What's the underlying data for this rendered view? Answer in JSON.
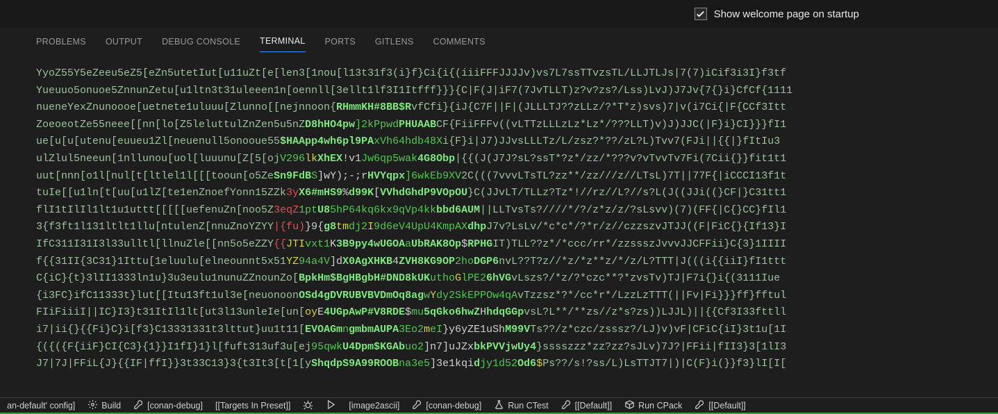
{
  "header": {
    "welcome_checkbox_label": "Show welcome page on startup",
    "welcome_checked": true
  },
  "panel": {
    "tabs": [
      {
        "label": "PROBLEMS",
        "active": false
      },
      {
        "label": "OUTPUT",
        "active": false
      },
      {
        "label": "DEBUG CONSOLE",
        "active": false
      },
      {
        "label": "TERMINAL",
        "active": true
      },
      {
        "label": "PORTS",
        "active": false
      },
      {
        "label": "GITLENS",
        "active": false
      },
      {
        "label": "COMMENTS",
        "active": false
      }
    ]
  },
  "terminal": {
    "lines": [
      [
        {
          "t": "YyoZ55Y5eZeeu5eZ5[eZn5utetIut[u11uZt[e[len3[1nou[l13t31f3(i}f}Ci{i{(iiiFFFJJJJv)vs7L7ssTTvzsTL/LLJTLJs|7(7)iCif3i3I}f3tf",
          "c": "wg"
        }
      ],
      [
        {
          "t": "Yueuuo5onuoe5ZnnunZetu[u1ltn3t31uleeen1n[oennll[3ellt1lf3I1Itfff}}}{C|F(J|iF7(7JvTLLT)z?v?zs?/Lss)LvJ)J7Jv{7{}i}CfCf{1111",
          "c": "wg"
        }
      ],
      [
        {
          "t": "nueneYexZnunoooe[uetnete1uluuu[Zlunno[[nejnnoon{",
          "c": "wg"
        },
        {
          "t": "RHmmKH#8BB$R",
          "c": "bg"
        },
        {
          "t": "vfCfi}{iJ{C7F||F|(JLLLTJ??zLLz/?*T*z)svs)7|v(i7Ci{|F{CCf3Itt",
          "c": "wg"
        }
      ],
      [
        {
          "t": "ZoeoeotZe55neee[[nn[lo[Z5leluttulZnZen5u5nZ",
          "c": "wg"
        },
        {
          "t": "D8hHO4pw",
          "c": "bg"
        },
        {
          "t": "]2kPpwd",
          "c": "g"
        },
        {
          "t": "PHUAAB",
          "c": "bg"
        },
        {
          "t": "CF{FiiFFFv((vLTTzLLLzLz*Lz*/???LLT)v)J)JJC(|F}i}CI}}}fI1",
          "c": "wg"
        }
      ],
      [
        {
          "t": "ue[u[u[utenu[euueu1Zl[neuenull5onooue55",
          "c": "wg"
        },
        {
          "t": "$HAApp4wh6pl9PA",
          "c": "bg"
        },
        {
          "t": "xVh64hdb48X",
          "c": "g"
        },
        {
          "t": "i{F}i|J7)JJvsLLLTz/L/zsz?*??/zL?L)Tvv7(FJi||{{|}fItIu3",
          "c": "wg"
        }
      ],
      [
        {
          "t": "ulZlul5neeun[1nllunou[uol[luuunu[Z[5[oj",
          "c": "wg"
        },
        {
          "t": "V296",
          "c": "g"
        },
        {
          "t": "lk",
          "c": "y"
        },
        {
          "t": "XhEX",
          "c": "bg"
        },
        {
          "t": "!v1",
          "c": "w"
        },
        {
          "t": "Jw6qp5wak",
          "c": "g"
        },
        {
          "t": "4G8Obp",
          "c": "bg"
        },
        {
          "t": "|{{(J(J7J?sL?ssT*?z*/zz/*???v?vTvvTv7Fi(7Cii{}}fit1t1",
          "c": "wg"
        }
      ],
      [
        {
          "t": "uut[nnn[o1l[nul[t[ltlel1l[[[tooun[o5Ze",
          "c": "wg"
        },
        {
          "t": "Sn9FdB",
          "c": "bg"
        },
        {
          "t": "S",
          "c": "g"
        },
        {
          "t": "]wY);-;r",
          "c": "w"
        },
        {
          "t": "HVYqpx",
          "c": "bg"
        },
        {
          "t": "]6wkEb9XV",
          "c": "g"
        },
        {
          "t": "2C(((7vvvLTsTL?zz**/zz///z//LTsL)7T||77F{|iCCCI13f1t",
          "c": "wg"
        }
      ],
      [
        {
          "t": "tuIe[[u1ln[t[uu[u1lZ[te1enZnoefYonn15ZZk",
          "c": "wg"
        },
        {
          "t": "3y",
          "c": "r"
        },
        {
          "t": "X6#mHS9",
          "c": "bg"
        },
        {
          "t": "%",
          "c": "w"
        },
        {
          "t": "d99K",
          "c": "bg"
        },
        {
          "t": "[",
          "c": "w"
        },
        {
          "t": "VVhdGhdP9VOpOU",
          "c": "bg"
        },
        {
          "t": "}C(JJvLT/TLLz?Tz*!//rz//L?//s?L(J((JJi((}CF|}C31tt1",
          "c": "wg"
        }
      ],
      [
        {
          "t": "flI1tIlIl1lt1u1uttt[[[[[uefenuZn[noo5Z",
          "c": "wg"
        },
        {
          "t": "3eqZ",
          "c": "r"
        },
        {
          "t": "1pt",
          "c": "g"
        },
        {
          "t": "U8",
          "c": "bg"
        },
        {
          "t": "5hP64kq6kx9qVp4kk",
          "c": "g"
        },
        {
          "t": "bbd6AUM",
          "c": "bg"
        },
        {
          "t": "||LLTvsTs?////*/?/z*z/z/?sLsvv)(7)(FF{|C{}CC}fIl1",
          "c": "wg"
        }
      ],
      [
        {
          "t": "3{f3ft1l131ltlt1llu[ntulenZ[nnuZnoYZYY",
          "c": "wg"
        },
        {
          "t": "|{fu)",
          "c": "r"
        },
        {
          "t": "}9{",
          "c": "w"
        },
        {
          "t": "g8",
          "c": "bg"
        },
        {
          "t": "tm",
          "c": "y"
        },
        {
          "t": "dj2",
          "c": "g"
        },
        {
          "t": "I",
          "c": "y"
        },
        {
          "t": "9d6eV4UpU4KmpAX",
          "c": "g"
        },
        {
          "t": "dhp",
          "c": "bg"
        },
        {
          "t": "J7v?LsLv/*c*c*/?*r/z//czzszvJTJJ((F|FiC{}{If13}I",
          "c": "wg"
        }
      ],
      [
        {
          "t": "IfC311I31I3l33ulltl[llnuZle[[nn5o5eZZY",
          "c": "wg"
        },
        {
          "t": "{{",
          "c": "r"
        },
        {
          "t": "JTI",
          "c": "y"
        },
        {
          "t": "vxt1",
          "c": "g"
        },
        {
          "t": "K",
          "c": "w"
        },
        {
          "t": "3B9py4wUGOA",
          "c": "bg"
        },
        {
          "t": "a",
          "c": "g"
        },
        {
          "t": "UbRAK8Op",
          "c": "bg"
        },
        {
          "t": "$",
          "c": "w"
        },
        {
          "t": "RPHG",
          "c": "bg"
        },
        {
          "t": "IT)TLL??z*/*ccc/rr*/zzssszJvvvJJCFFii}C{3}1IIII",
          "c": "wg"
        }
      ],
      [
        {
          "t": "f{{31II{3C31}1Ittu[1eluulu[elneounnt5x51",
          "c": "wg"
        },
        {
          "t": "YZ",
          "c": "y"
        },
        {
          "t": "94a4V",
          "c": "g"
        },
        {
          "t": "]d",
          "c": "w"
        },
        {
          "t": "X0AgXHKB",
          "c": "bg"
        },
        {
          "t": "4",
          "c": "w"
        },
        {
          "t": "ZVH8KG9OP",
          "c": "bg"
        },
        {
          "t": "2ho",
          "c": "g"
        },
        {
          "t": "DGP6",
          "c": "bg"
        },
        {
          "t": "nvL??T?z//*z/*z**z/*/z/L?TTT|J(((i{{iiI}fI1ttt",
          "c": "wg"
        }
      ],
      [
        {
          "t": "C{iC}{t}3lII1333ln1u}3u3eulu1nunuZZnounZo[",
          "c": "wg"
        },
        {
          "t": "BpkHm$BgHBgbH#DND8kUK",
          "c": "bg"
        },
        {
          "t": "utho",
          "c": "g"
        },
        {
          "t": "G",
          "c": "y"
        },
        {
          "t": "lPE2",
          "c": "g"
        },
        {
          "t": "6hVG",
          "c": "bg"
        },
        {
          "t": "vLszs?/*z/?*czc**?*zvsTv)TJ|F7i{}i{(3111Iue",
          "c": "wg"
        }
      ],
      [
        {
          "t": "{i3FC}ifC11333t}lut[[Itu13ft1ul3e[neuonoon",
          "c": "wg"
        },
        {
          "t": "OSd4gDVRUBVBVDmOq8ag",
          "c": "bg"
        },
        {
          "t": "w",
          "c": "g"
        },
        {
          "t": "Y",
          "c": "y"
        },
        {
          "t": "dy2SkEPPOw4qA",
          "c": "g"
        },
        {
          "t": "vTzzsz*?*/cc*r*/LzzLzTTT(||Fv|Fi}}}ff}fftul",
          "c": "wg"
        }
      ],
      [
        {
          "t": "FIiFiiiI||IC}I3}t31ItIl1lt[ut3l13unleIe[un[",
          "c": "wg"
        },
        {
          "t": "oy",
          "c": "y"
        },
        {
          "t": "E",
          "c": "w"
        },
        {
          "t": "4UGpAwP#V8RDE",
          "c": "bg"
        },
        {
          "t": "$",
          "c": "w"
        },
        {
          "t": "mu",
          "c": "g"
        },
        {
          "t": "5qGko6hwZ",
          "c": "bg"
        },
        {
          "t": "H",
          "c": "w"
        },
        {
          "t": "hdqGGp",
          "c": "bg"
        },
        {
          "t": "vsL?L**/**zs//z*s?zs))LJJL)||{{Cf3I33fttll",
          "c": "wg"
        }
      ],
      [
        {
          "t": "i7|ii{}{{Fi}C}i[f3}C13331331t3lttut}uu1t11[",
          "c": "wg"
        },
        {
          "t": "EVOAGm",
          "c": "bg"
        },
        {
          "t": "n",
          "c": "g"
        },
        {
          "t": "gmbmAUPA",
          "c": "bg"
        },
        {
          "t": "3Eo2",
          "c": "g"
        },
        {
          "t": "m",
          "c": "y"
        },
        {
          "t": "eI",
          "c": "g"
        },
        {
          "t": "}y6yZE1uSh",
          "c": "w"
        },
        {
          "t": "M99V",
          "c": "bg"
        },
        {
          "t": "Ts??/z*czc/zsssz?/LJ)v)vF|CFiC{iI}3t1u[1I",
          "c": "wg"
        }
      ],
      [
        {
          "t": "{({({F{iiF}CI{C3}{1}}I1fI}1}l[fuft313uf3u[ej",
          "c": "wg"
        },
        {
          "t": "95qwk",
          "c": "g"
        },
        {
          "t": "U4Dpm$KGAb",
          "c": "bg"
        },
        {
          "t": "uo2",
          "c": "g"
        },
        {
          "t": "]n7]uJZx",
          "c": "w"
        },
        {
          "t": "bkPVVjwUy4",
          "c": "bg"
        },
        {
          "t": "}sssszzz*zz?zz?sJLv)7J?|FFii|fII3}3[1lI3",
          "c": "wg"
        }
      ],
      [
        {
          "t": "J7|7J|FFiL{J}{{IF|ffI}}3t33C13}3{t3It3[t[1[y",
          "c": "wg"
        },
        {
          "t": "ShqdpS9A99ROOB",
          "c": "bg"
        },
        {
          "t": "na3e5",
          "c": "g"
        },
        {
          "t": "]3e1kqi",
          "c": "w"
        },
        {
          "t": "d",
          "c": "bg"
        },
        {
          "t": "jy1d52",
          "c": "g"
        },
        {
          "t": "Od6",
          "c": "bg"
        },
        {
          "t": "$",
          "c": "y"
        },
        {
          "t": "Ps??/s!?ss/L)LsTTJT7|)|C(F}i(}}f3}lI[I[",
          "c": "wg"
        }
      ]
    ]
  },
  "status": {
    "items": [
      {
        "name": "conan-config",
        "icon": null,
        "label": "an-default' config]"
      },
      {
        "name": "build",
        "icon": "gear",
        "label": "Build"
      },
      {
        "name": "conan-debug-tool",
        "icon": "wrench",
        "label": "[conan-debug]"
      },
      {
        "name": "targets",
        "icon": null,
        "label": "[[Targets In Preset]]"
      },
      {
        "name": "debug-run",
        "icon": "bug",
        "label": ""
      },
      {
        "name": "play",
        "icon": "play",
        "label": ""
      },
      {
        "name": "image2ascii",
        "icon": null,
        "label": "[image2ascii]"
      },
      {
        "name": "conan-debug-2",
        "icon": "wrench",
        "label": "[conan-debug]"
      },
      {
        "name": "run-ctest",
        "icon": "beaker",
        "label": "Run CTest"
      },
      {
        "name": "default-1",
        "icon": "wrench",
        "label": "[[Default]]"
      },
      {
        "name": "run-cpack",
        "icon": "package",
        "label": "Run CPack"
      },
      {
        "name": "default-2",
        "icon": "wrench",
        "label": "[[Default]]"
      }
    ]
  }
}
